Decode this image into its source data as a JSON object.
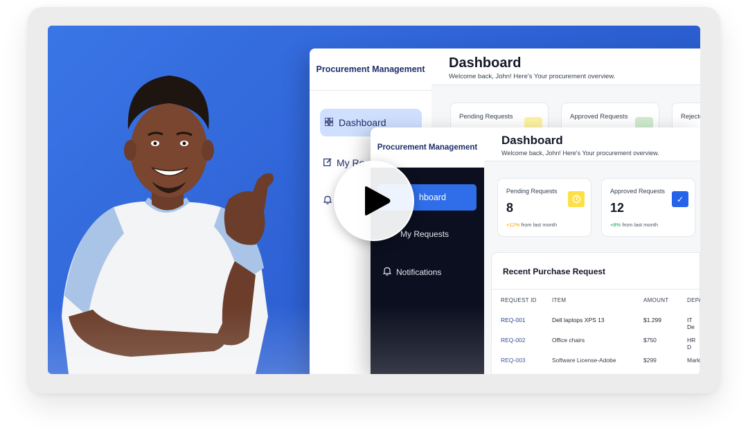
{
  "back_window": {
    "brand": "Procurement Management",
    "nav": {
      "dashboard": "Dashboard",
      "my_requests_partial": "My Re"
    },
    "header": {
      "title": "Dashboard",
      "subtitle": "Welcome back, John! Here's Your procurement overview."
    },
    "cards": [
      "Pending Requests",
      "Approved Requests",
      "Rejecte"
    ]
  },
  "front_window": {
    "brand": "Procurement Management",
    "nav": {
      "dashboard_partial": "hboard",
      "my_requests": "My Requests",
      "notifications": "Notifications"
    },
    "header": {
      "title": "Dashboard",
      "subtitle": "Welcome back, John! Here's Your procurement overview."
    },
    "stats": [
      {
        "label": "Pending Requests",
        "value": "8",
        "trend_value": "+12%",
        "trend_text": "from last month",
        "trend_color": "#f59e0b",
        "chip_color": "#fde047",
        "icon": "clock-icon"
      },
      {
        "label": "Approved Requests",
        "value": "12",
        "trend_value": "+8%",
        "trend_text": "from last month",
        "trend_color": "#16a34a",
        "chip_color": "#2563eb",
        "icon": "check-icon"
      }
    ],
    "recent": {
      "title": "Recent Purchase Request",
      "columns": [
        "REQUEST ID",
        "ITEM",
        "AMOUNT",
        "DEPA"
      ],
      "rows": [
        {
          "id": "REQ-001",
          "item": "Dell laptops XPS 13",
          "amount": "$1.299",
          "dept": "IT De"
        },
        {
          "id": "REQ-002",
          "item": "Office chairs",
          "amount": "$750",
          "dept": "HR D"
        },
        {
          "id": "REQ-003",
          "item": "Software License-Adobe",
          "amount": "$299",
          "dept": "Mark"
        }
      ]
    }
  },
  "player": {
    "play_icon": "play-icon"
  },
  "colors": {
    "background_blue": "#2f63d6",
    "accent_blue": "#2f6ee8",
    "dark_sidebar": "#0b0f1f",
    "brand_text": "#1f2d6b"
  }
}
